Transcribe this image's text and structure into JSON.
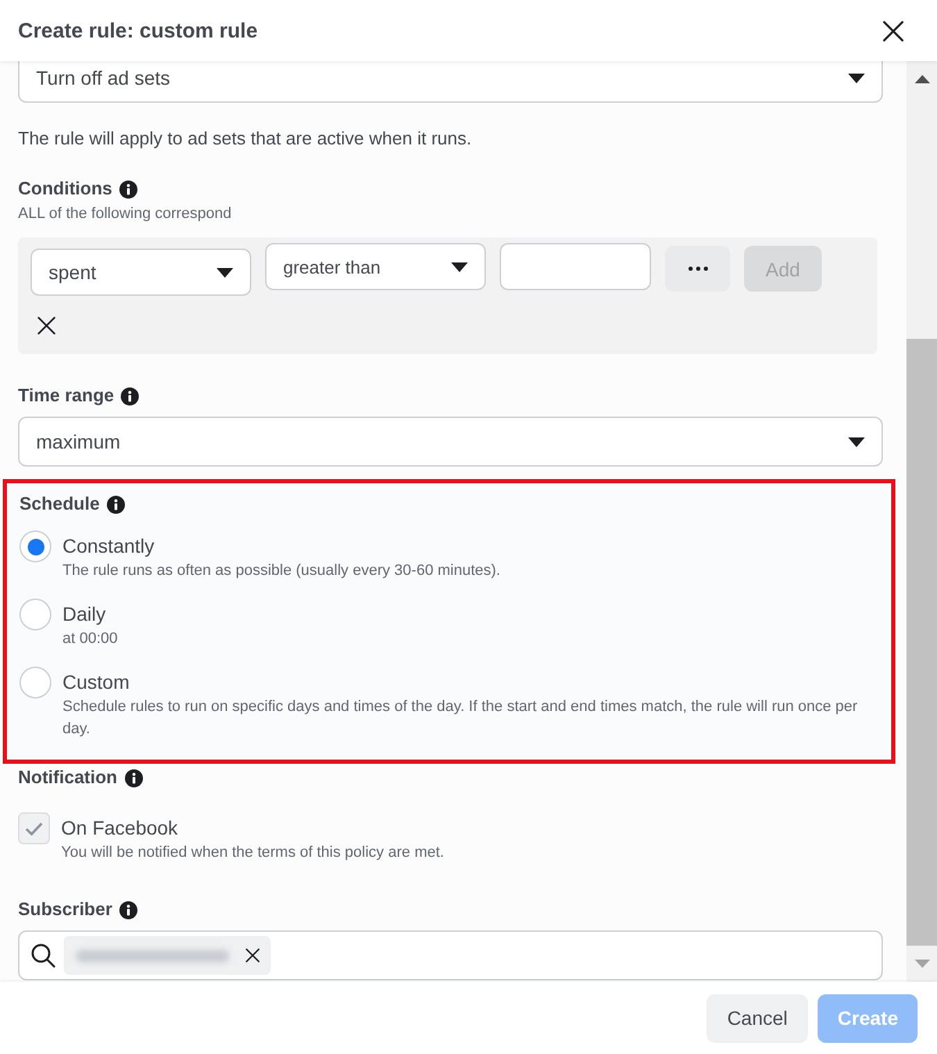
{
  "dialog": {
    "title": "Create rule: custom rule"
  },
  "action": {
    "value": "Turn off ad sets",
    "note": "The rule will apply to ad sets that are active when it runs."
  },
  "conditions": {
    "label": "Conditions",
    "hint": "ALL of the following correspond",
    "metric": "spent",
    "operator": "greater than",
    "add_button": {
      "label": "Add",
      "disabled": true
    }
  },
  "time_range": {
    "label": "Time range",
    "value": "maximum"
  },
  "schedule": {
    "label": "Schedule",
    "highlighted": true,
    "options": [
      {
        "label": "Constantly",
        "description": "The rule runs as often as possible (usually every 30-60 minutes).",
        "selected": true
      },
      {
        "label": "Daily",
        "description": "at 00:00",
        "selected": false
      },
      {
        "label": "Custom",
        "description": "Schedule rules to run on specific days and times of the day. If the start and end times match, the rule will run once per day.",
        "selected": false
      }
    ]
  },
  "notification": {
    "label": "Notification",
    "options": [
      {
        "label": "On Facebook",
        "description": "You will be notified when the terms of this policy are met.",
        "checked": true,
        "disabled": true
      }
    ]
  },
  "subscriber": {
    "label": "Subscriber"
  },
  "footer": {
    "buttons": [
      {
        "label": "Cancel",
        "kind": "secondary",
        "disabled": false
      },
      {
        "label": "Create",
        "kind": "primary",
        "disabled": true
      }
    ]
  }
}
